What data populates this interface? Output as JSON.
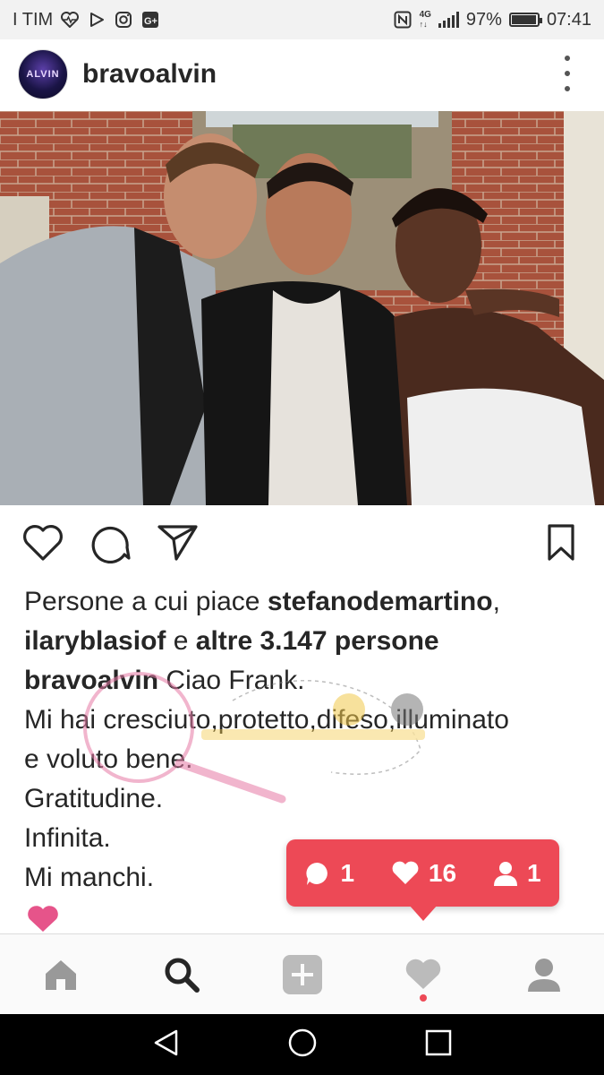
{
  "status_bar": {
    "carrier": "I TIM",
    "network": "4G",
    "battery": "97%",
    "battery_level": 0.97,
    "time": "07:41"
  },
  "post": {
    "username": "bravoalvin",
    "avatar_text": "ALVIN",
    "likes": {
      "prefix": "Persone a cui piace ",
      "user1": "stefanodemartino",
      "sep1": ",",
      "user2": "ilaryblasiof",
      "mid": " e ",
      "others": "altre 3.147 persone"
    },
    "caption": {
      "author": "bravoalvin",
      "line1": " Ciao Frank.",
      "line2": "Mi hai cresciuto,protetto,difeso,illuminato",
      "line3": "e voluto bene.",
      "line4": "Gratitudine.",
      "line5": "Infinita.",
      "line6": "Mi manchi."
    }
  },
  "activity": {
    "comments": "1",
    "likes": "16",
    "followers": "1"
  },
  "icons": {
    "status": [
      "heart-pulse-icon",
      "play-store-icon",
      "instagram-icon",
      "google-plus-icon",
      "nfc-icon",
      "signal-icon",
      "battery-icon"
    ],
    "actions": [
      "heart-icon",
      "comment-icon",
      "share-icon",
      "bookmark-icon"
    ],
    "nav": [
      "home-icon",
      "search-icon",
      "add-icon",
      "activity-heart-icon",
      "profile-icon"
    ],
    "android": [
      "back-icon",
      "home-circle-icon",
      "recents-icon"
    ]
  },
  "colors": {
    "accent": "#ed4956",
    "text": "#262626",
    "watermark_pink": "#e67aa6"
  }
}
